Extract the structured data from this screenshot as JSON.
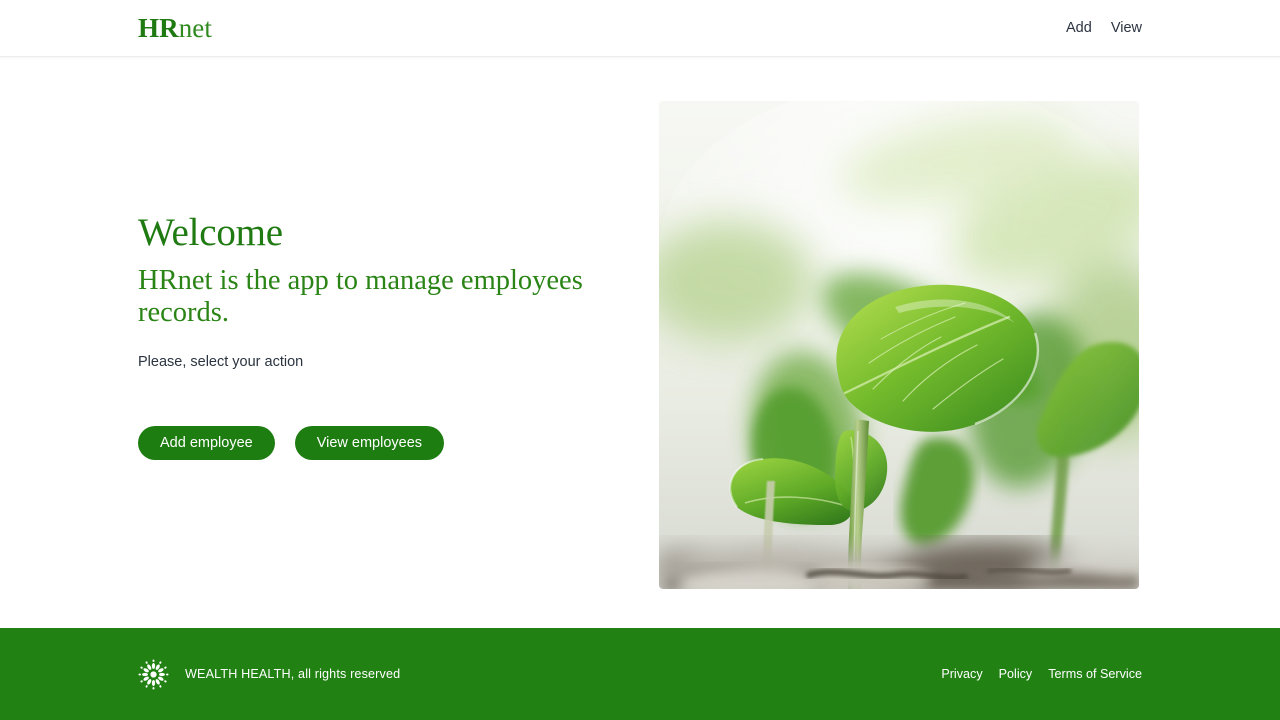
{
  "header": {
    "brand": {
      "strong": "HR",
      "light": "net"
    },
    "nav": [
      {
        "label": "Add",
        "name": "nav-link-add"
      },
      {
        "label": "View",
        "name": "nav-link-view"
      }
    ]
  },
  "hero": {
    "title": "Welcome",
    "subtitle": "HRnet is the app to manage employees records.",
    "hint": "Please, select your action",
    "buttons": [
      {
        "label": "Add employee"
      },
      {
        "label": "View employees"
      }
    ],
    "image": {
      "alt": "green seedlings sprouting from soil",
      "icon": "plant-seedling-photo"
    }
  },
  "footer": {
    "logo_icon": "starburst-flower-icon",
    "copyright": "WEALTH HEALTH, all rights reserved",
    "links": [
      {
        "label": "Privacy"
      },
      {
        "label": "Policy"
      },
      {
        "label": "Terms of Service"
      }
    ]
  },
  "colors": {
    "brand_green": "#1f7a12",
    "button_green": "#1e7d10",
    "footer_green": "#218113",
    "text_dark": "#2b3440",
    "page_background": "#ffffff"
  }
}
